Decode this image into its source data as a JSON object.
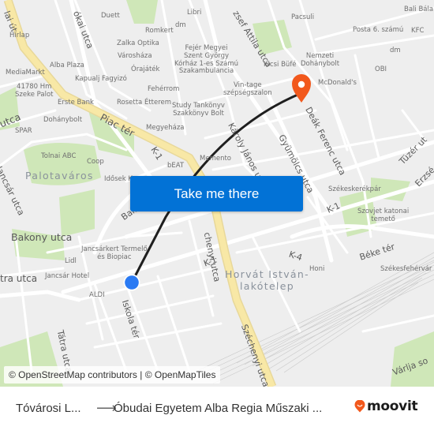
{
  "map": {
    "colors": {
      "background": "#eeeeee",
      "road": "#ffffff",
      "major_road": "#f8e49c",
      "park": "#c9e5b0",
      "route_line": "#1f1f1f",
      "origin_marker": "#2a7af3",
      "destination_marker": "#f2581c",
      "cta_button": "#0272d6"
    },
    "streets": [
      "Piac tér",
      "Bakony utca",
      "Palotai út",
      "Jókai utca",
      "József Attila utca",
      "Károly János utca",
      "Gyümölcs utca",
      "Deák Ferenc utca",
      "Széchenyi utca",
      "Tüzér utca",
      "Erzsébet utca",
      "Béke tér",
      "Iskola tér",
      "Tátra utca",
      "Jancsár utca",
      "Balatoni út",
      "Várlja sor",
      "Mátra utca"
    ],
    "street_labels": {
      "palotai": "lai út",
      "jokai": "ókai utca",
      "jozsef_attila": "zsef Attila utca",
      "karoly_janos": "Károly János utca",
      "gyumolcs": "Gyümölcs utca",
      "deak": "Deák Ferenc utca",
      "szechenyi_upper": "chenyi utca",
      "szechenyi_lower": "Széchenyi utca",
      "tuzer": "Tüzér ut",
      "erzsebet": "Erzsé",
      "beke": "Béke tér",
      "iskola": "Iskola tér",
      "tatra_v": "Tátra utca",
      "tatra_h": "tra utca",
      "jancsar": "Jancsár utca",
      "bakony": "Bakony utca",
      "piac": "Piac tér",
      "balatoni": "Bala",
      "utca_left": "utca",
      "varalja": "Várlja so"
    },
    "route_refs": [
      "K-1",
      "K-1",
      "K-1",
      "K-4"
    ],
    "districts": [
      {
        "name": "Palotaváros"
      },
      {
        "name": "Horvát István-\nlakótelep"
      }
    ],
    "pois": [
      "Hírlap",
      "Duett",
      "Libri",
      "Pacsuli",
      "Bali Bála",
      "Romkert",
      "dm",
      "Zalka Optika",
      "Városháza",
      "Alba Plaza",
      "MediaMarkt",
      "Kapualj Fagyizó",
      "Órajáték",
      "Fejér Megyei\nSzent György\nKórház 1-es Számú\nSzakambulancia",
      "Fehérrom",
      "41780 Hm\nSzeke Palot",
      "Erste Bank",
      "Rosetta Étterem",
      "Study Tankönyv\nSzakkönyv Bolt",
      "Dohánybolt",
      "Megyeháza",
      "SPAR",
      "Vin-tage\nszépségszalon",
      "Kicsi Büfé",
      "Nemzeti\nDohánybolt",
      "McDonald's",
      "Posta 6. számú",
      "KFC",
      "dm",
      "OBI",
      "Tolnai ABC",
      "Coop",
      "Idősek K",
      "bEAT",
      "Memento",
      "Székeskerékpár",
      "Szovjet katonai\ntemető",
      "Honi",
      "Székesfehérvár",
      "Jancsárkert Termelő\nés Biopiac",
      "Lidl",
      "Jancsár Hotel",
      "ALDI"
    ],
    "origin_marker": "origin-stop",
    "destination_marker": "destination-pin"
  },
  "cta": {
    "label": "Take me there"
  },
  "attribution": "© OpenStreetMap contributors | © OpenMapTiles",
  "footer": {
    "from": "Tóvárosi L...",
    "arrow": "⟶",
    "to": "Óbudai Egyetem Alba Regia Műszaki ...",
    "brand": "moovit",
    "brand_color": "#f2581c"
  }
}
